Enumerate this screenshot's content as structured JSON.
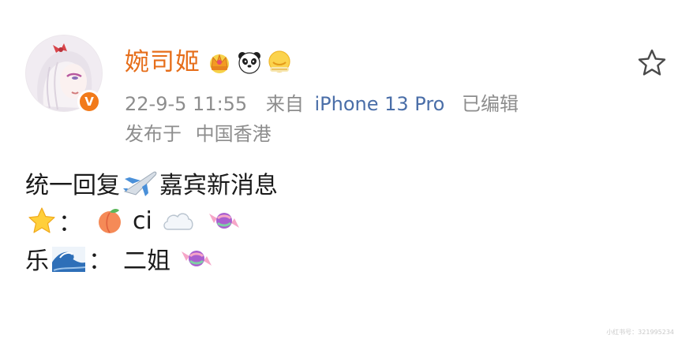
{
  "post": {
    "author": {
      "name": "婉司姬",
      "verified_mark": "V",
      "badges": [
        "crown-badge-icon",
        "panda-badge-icon",
        "sun-badge-icon"
      ]
    },
    "timestamp": "22-9-5 11:55",
    "source_prefix": "来自",
    "device": "iPhone 13 Pro",
    "edited_label": "已编辑",
    "published_label": "发布于",
    "location": "中国香港",
    "lines": [
      {
        "text_a": "统一回复",
        "text_b": "嘉宾新消息"
      },
      {
        "sep": "：",
        "text": "ci"
      },
      {
        "prefix": "乐",
        "sep": "：",
        "text": "二姐"
      }
    ],
    "watermark": "小红书号：321995234"
  },
  "icons": {
    "favorite": "star-outline-icon"
  },
  "colors": {
    "username": "#e66e1a",
    "device_link": "#4a6ea8",
    "meta_text": "#8d8d8d",
    "verified": "#f27a1a"
  }
}
